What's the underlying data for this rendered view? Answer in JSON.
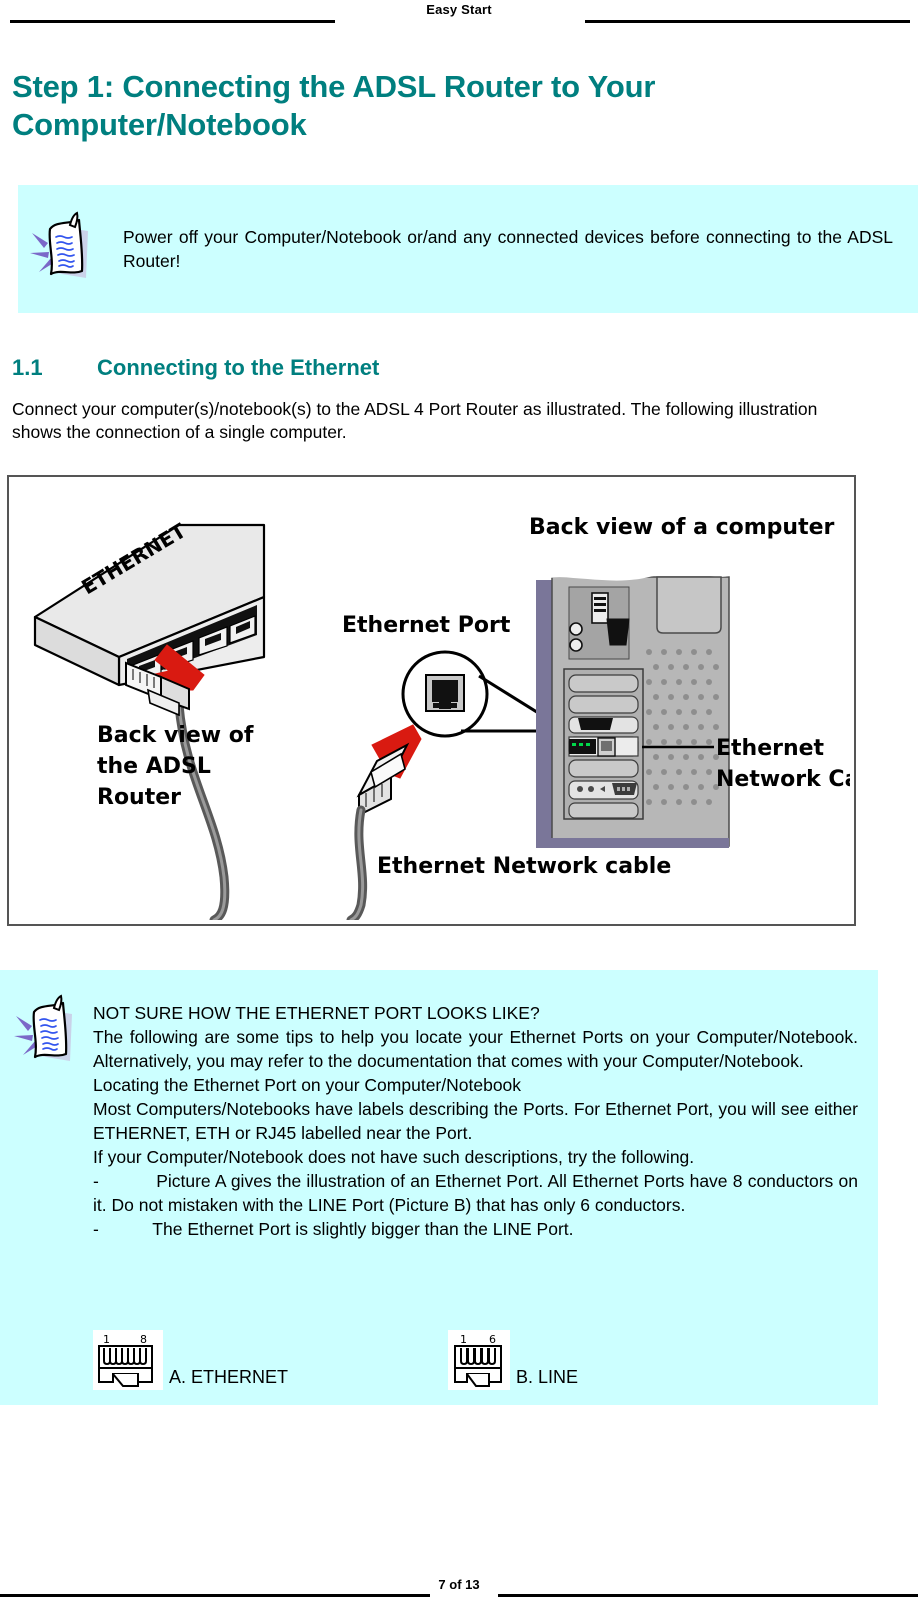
{
  "header": {
    "title": "Easy Start"
  },
  "heading": {
    "step_title": "Step 1:  Connecting the ADSL Router to Your Computer/Notebook",
    "color": "#007F7F"
  },
  "note_top": {
    "icon": "note-memo-icon",
    "text": "Power off your Computer/Notebook or/and any connected devices before connecting to the ADSL Router!",
    "background": "#CCFFFF"
  },
  "section": {
    "number": "1.1",
    "title": "Connecting to the Ethernet",
    "body": "Connect your computer(s)/notebook(s) to the ADSL 4 Port Router as illustrated. The following illustration shows the connection of a single computer."
  },
  "diagram": {
    "labels": {
      "router_device": "ETHERNET",
      "router_caption": "Back view of\nthe ADSL\nRouter",
      "router_caption_line1": "Back view of",
      "router_caption_line2": "the ADSL",
      "router_caption_line3": "Router",
      "ethernet_port": "Ethernet  Port",
      "computer_caption": "Back view of a computer",
      "network_card_line1": "Ethernet",
      "network_card_line2": "Network Card",
      "cable_caption": "Ethernet  Network  cable"
    },
    "colors": {
      "arrow": "#D91A11",
      "router_body": "#E6E6E6",
      "case_front": "#B3B3B3",
      "case_side": "#7A7699",
      "cable": "#595959",
      "led": "#00CC44"
    }
  },
  "note_bottom": {
    "icon": "note-memo-icon",
    "background": "#CCFFFF",
    "paragraphs": [
      "NOT SURE HOW THE ETHERNET PORT LOOKS LIKE?",
      "The following are some tips to help you locate your Ethernet Ports on your Computer/Notebook.  Alternatively, you may refer to the documentation that comes with your Computer/Notebook.",
      "Locating the Ethernet Port on your Computer/Notebook",
      "Most Computers/Notebooks have labels describing the Ports.  For Ethernet Port, you will see either ETHERNET, ETH or RJ45 labelled near the Port.",
      "If your Computer/Notebook does not have such descriptions, try the following.",
      "-           Picture A gives the illustration of an Ethernet Port.  All Ethernet Ports have 8 conductors on it.  Do not mistaken with the LINE Port (Picture B) that has only 6 conductors.",
      "-           The Ethernet Port is slightly bigger than the LINE Port."
    ]
  },
  "plugs": [
    {
      "id": "ethernet-plug",
      "pin_first": "1",
      "pin_last": "8",
      "conductors": 8,
      "caption": "A.  ETHERNET"
    },
    {
      "id": "line-plug",
      "pin_first": "1",
      "pin_last": "6",
      "conductors": 6,
      "caption": "B.  LINE"
    }
  ],
  "footer": {
    "page_label": "7 of 13"
  }
}
